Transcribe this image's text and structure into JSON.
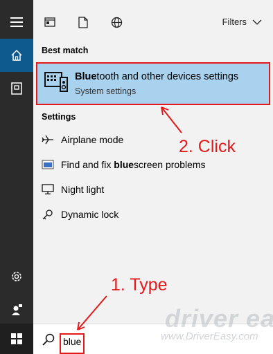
{
  "filters": {
    "label": "Filters"
  },
  "best_match": {
    "header": "Best match",
    "title_bold": "Blue",
    "title_rest": "tooth and other devices settings",
    "subtitle": "System settings"
  },
  "settings": {
    "header": "Settings",
    "items": [
      {
        "label": "Airplane mode",
        "icon": "airplane-icon"
      },
      {
        "label_pre": "Find and fix ",
        "label_bold": "blue",
        "label_post": "screen problems",
        "icon": "bluescreen-icon"
      },
      {
        "label": "Night light",
        "icon": "monitor-icon"
      },
      {
        "label": "Dynamic lock",
        "icon": "key-icon"
      }
    ]
  },
  "search": {
    "value": "blue"
  },
  "annotations": {
    "step2": "2. Click",
    "step1": "1. Type"
  },
  "watermark": {
    "logo": "driver easy",
    "url": "www.DriverEasy.com"
  },
  "colors": {
    "highlight": "#a9d2ee",
    "annotation": "#e3191a",
    "rail": "#2b2b2b",
    "rail_active": "#0e5a8f"
  }
}
